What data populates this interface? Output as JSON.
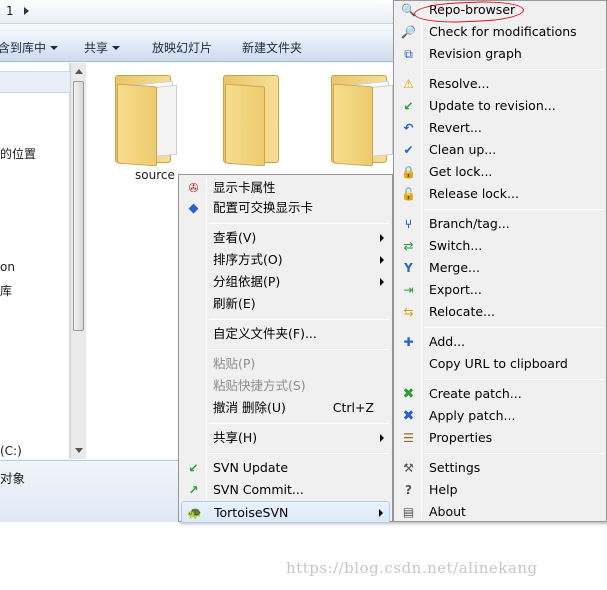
{
  "address_bar": {
    "number": "1"
  },
  "toolbar": {
    "include_in_library": "含到库中",
    "share": "共享",
    "slideshow": "放映幻灯片",
    "new_folder": "新建文件夹"
  },
  "nav_pane": {
    "items": [
      "的位置",
      "on",
      "库",
      "(C:)"
    ]
  },
  "content": {
    "folders": [
      {
        "label": "source"
      },
      {
        "label": ""
      },
      {
        "label": ""
      }
    ]
  },
  "status_bar": {
    "text": "对象"
  },
  "context_menu": {
    "items": {
      "display_props": "显示卡属性",
      "switchable_gfx": "配置可交换显示卡",
      "view": "查看(V)",
      "sort_by": "排序方式(O)",
      "group_by": "分组依据(P)",
      "refresh": "刷新(E)",
      "customize_folder": "自定义文件夹(F)...",
      "paste": "粘贴(P)",
      "paste_shortcut": "粘贴快捷方式(S)",
      "undo_delete": "撤消 删除(U)",
      "undo_delete_shortcut": "Ctrl+Z",
      "share": "共享(H)",
      "svn_update": "SVN Update",
      "svn_commit": "SVN Commit...",
      "tortoisesvn": "TortoiseSVN"
    }
  },
  "svn_menu": {
    "items": {
      "repo_browser": "Repo-browser",
      "check_modifications": "Check for modifications",
      "revision_graph": "Revision graph",
      "resolve": "Resolve...",
      "update_to_revision": "Update to revision...",
      "revert": "Revert...",
      "clean_up": "Clean up...",
      "get_lock": "Get lock...",
      "release_lock": "Release lock...",
      "branch_tag": "Branch/tag...",
      "switch": "Switch...",
      "merge": "Merge...",
      "export": "Export...",
      "relocate": "Relocate...",
      "add": "Add...",
      "copy_url": "Copy URL to clipboard",
      "create_patch": "Create patch...",
      "apply_patch": "Apply patch...",
      "properties": "Properties",
      "settings": "Settings",
      "help": "Help",
      "about": "About"
    }
  },
  "watermark": "https://blog.csdn.net/alinekang",
  "colors": {
    "menu_bg": "#f0f0f0",
    "highlight_border": "#aecdf0",
    "annotation_red": "#d9141b",
    "svn_green": "#2a9d3a",
    "svn_blue": "#2a62c9"
  }
}
